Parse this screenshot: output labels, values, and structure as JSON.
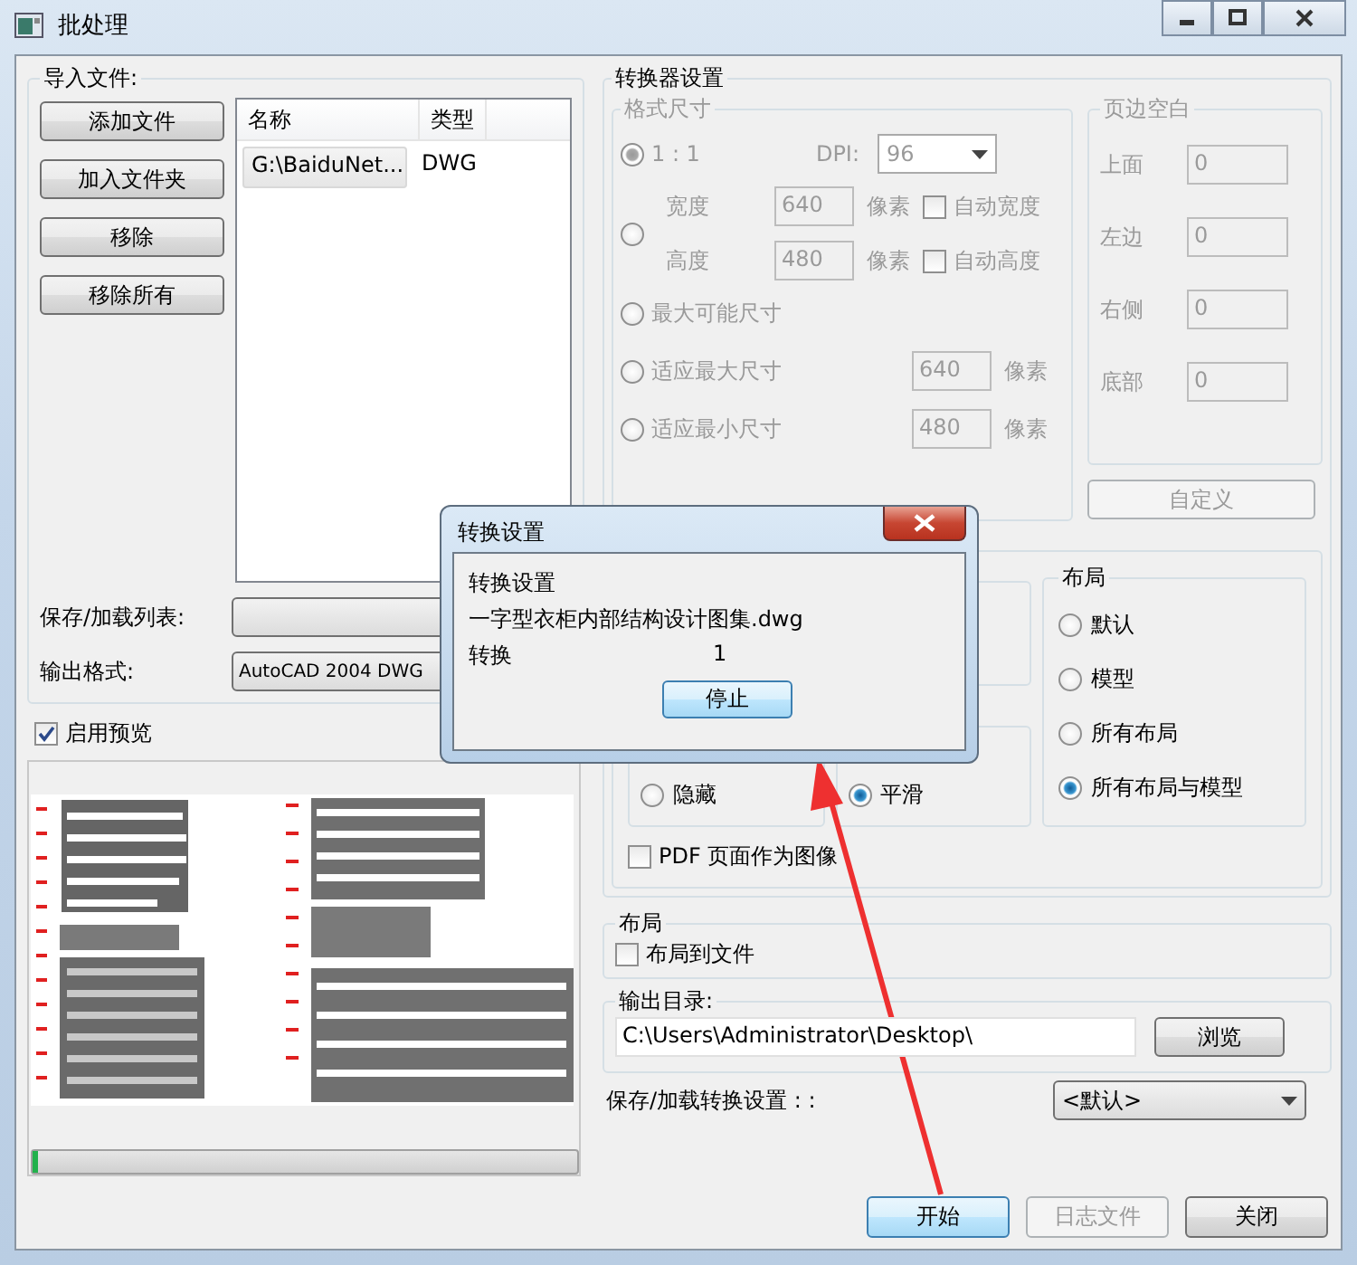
{
  "window": {
    "title": "批处理"
  },
  "import": {
    "title": "导入文件:",
    "buttons": [
      "添加文件",
      "加入文件夹",
      "移除",
      "移除所有"
    ],
    "file_list": {
      "columns": [
        "名称",
        "类型"
      ],
      "rows": [
        {
          "cells": [
            "G:\\BaiduNet...",
            "DWG"
          ]
        }
      ]
    },
    "save_load_list": {
      "label": "保存/加载列表:"
    },
    "output_format": {
      "label": "输出格式:",
      "value": "AutoCAD 2004 DWG"
    }
  },
  "preview": {
    "label": "启用预览",
    "checked": true,
    "progress": {
      "level": 0.01
    }
  },
  "converter": {
    "title": "转换器设置",
    "format_size": {
      "title": "格式尺寸",
      "disabled": true,
      "options": [
        {
          "kind": "ratio",
          "label": "1 : 1",
          "selected": true,
          "dpi_label": "DPI:",
          "dpi": "96"
        },
        {
          "kind": "custom",
          "selected": false,
          "rows": [
            {
              "label": "宽度",
              "value": "640",
              "unit": "像素",
              "auto_label": "自动宽度",
              "auto": false
            },
            {
              "label": "高度",
              "value": "480",
              "unit": "像素",
              "auto_label": "自动高度",
              "auto": false
            }
          ]
        },
        {
          "kind": "simple",
          "label": "最大可能尺寸",
          "selected": false
        },
        {
          "kind": "fit",
          "label": "适应最大尺寸",
          "selected": false,
          "value": "640",
          "unit": "像素"
        },
        {
          "kind": "fit",
          "label": "适应最小尺寸",
          "selected": false,
          "value": "480",
          "unit": "像素"
        }
      ]
    },
    "margins": {
      "title": "页边空白",
      "disabled": true,
      "fields": [
        {
          "label": "上面",
          "value": "0"
        },
        {
          "label": "左边",
          "value": "0"
        },
        {
          "label": "右侧",
          "value": "0"
        },
        {
          "label": "底部",
          "value": "0"
        }
      ]
    },
    "custom_button": {
      "label": "自定义",
      "disabled": true
    },
    "hidden_options": [
      {
        "label": "隐藏",
        "selected": false
      },
      {
        "label": "平滑",
        "selected": true
      }
    ],
    "layout": {
      "title": "布局",
      "options": [
        {
          "label": "默认",
          "selected": false
        },
        {
          "label": "模型",
          "selected": false
        },
        {
          "label": "所有布局",
          "selected": false
        },
        {
          "label": "所有布局与模型",
          "selected": true
        }
      ]
    },
    "pdf_as_image": {
      "label": "PDF 页面作为图像",
      "checked": false
    }
  },
  "layout_group": {
    "title": "布局",
    "layout_to_file": {
      "label": "布局到文件",
      "checked": false
    }
  },
  "output_dir": {
    "label": "输出目录:",
    "value": "C:\\Users\\Administrator\\Desktop\\",
    "browse": "浏览"
  },
  "save_load_settings": {
    "label": "保存/加载转换设置 : :",
    "value": "<默认>"
  },
  "footer_buttons": [
    {
      "label": "开始",
      "kind": "default",
      "disabled": false
    },
    {
      "label": "日志文件",
      "kind": "normal",
      "disabled": true
    },
    {
      "label": "关闭",
      "kind": "normal",
      "disabled": false
    }
  ],
  "progress_dialog": {
    "title": "转换设置",
    "heading": "转换设置",
    "file": "一字型衣柜内部结构设计图集.dwg",
    "status_label": "转换",
    "count": "1",
    "stop": "停止"
  }
}
